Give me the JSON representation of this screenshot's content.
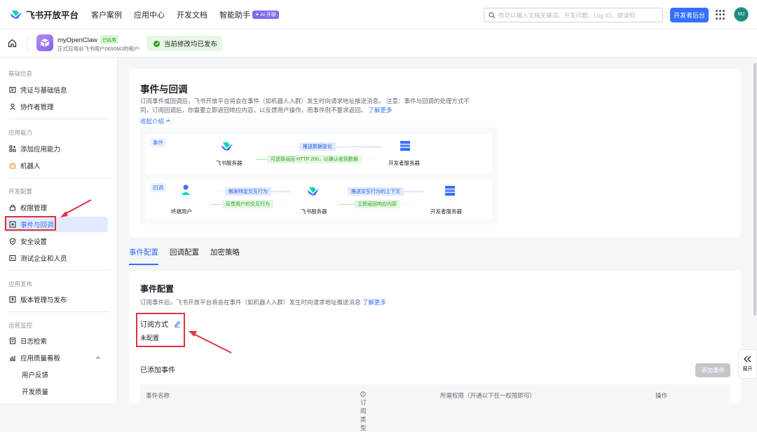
{
  "header": {
    "brand": "飞书开放平台",
    "nav": [
      "客户案例",
      "应用中心",
      "开发文档",
      "智能助手"
    ],
    "ai_badge": "✦ AI 开聊",
    "search_placeholder": "你可以输入文档关键词、开发问题、Log ID、错误码",
    "dev_console": "开发者后台",
    "avatar": "MJ"
  },
  "app": {
    "name": "myOpenClaw",
    "badge": "已启用",
    "subtitle": "正式应用@飞书用户0650MJ的租户",
    "status": "当前修改均已发布"
  },
  "sidebar": {
    "sections": [
      {
        "title": "基础信息",
        "items": [
          {
            "label": "凭证与基础信息",
            "icon": "credential-icon"
          },
          {
            "label": "协作者管理",
            "icon": "user-icon"
          }
        ]
      },
      {
        "title": "应用能力",
        "items": [
          {
            "label": "添加应用能力",
            "icon": "add-grid-icon"
          },
          {
            "label": "机器人",
            "icon": "robot-icon"
          }
        ]
      },
      {
        "title": "开发配置",
        "items": [
          {
            "label": "权限管理",
            "icon": "lock-icon"
          },
          {
            "label": "事件与回调",
            "icon": "event-icon"
          },
          {
            "label": "安全设置",
            "icon": "shield-icon"
          },
          {
            "label": "测试企业和人员",
            "icon": "test-icon"
          }
        ]
      },
      {
        "title": "应用发布",
        "items": [
          {
            "label": "版本管理与发布",
            "icon": "upload-icon"
          }
        ]
      },
      {
        "title": "运营监控",
        "items": [
          {
            "label": "日志检索",
            "icon": "log-icon"
          },
          {
            "label": "应用质量看板",
            "icon": "dashboard-icon"
          },
          {
            "label": "用户反馈",
            "icon": ""
          },
          {
            "label": "开发质量",
            "icon": ""
          }
        ]
      }
    ],
    "active": "事件与回调"
  },
  "intro": {
    "title": "事件与回调",
    "desc_line1": "订阅事件或回调后，飞书开放平台将会在事件（如机器人入群）发生时向请求地址推送消息。 注意：事件与回调的处理方式不",
    "desc_line2": "同，订阅回调后，你需要立即返回响应内容，以反馈用户操作，而事件则不要求返回。",
    "learn_more": "了解更多",
    "collapse": "收起介绍",
    "diagram": {
      "event_tag": "事件",
      "callback_tag": "回调",
      "feishu_server": "飞书服务器",
      "dev_server": "开发者服务器",
      "end_user": "终端用户",
      "push_data": "推送数据变化",
      "return_200": "可选择返回 HTTP 200，以确认收到数据",
      "trigger": "触发特定交互行为",
      "feedback": "反馈用户的交互行为",
      "push_context": "推送交互行为的上下文",
      "return_now": "立即返回响应内容"
    }
  },
  "tabs": [
    "事件配置",
    "回调配置",
    "加密策略"
  ],
  "event_config": {
    "title": "事件配置",
    "desc": "订阅事件后，飞书开放平台将会在事件（如机器人入群）发生时向请求地址推送消息",
    "learn_more": "了解更多",
    "sub_label": "订阅方式",
    "sub_value": "未配置",
    "added_title": "已添加事件",
    "add_button": "添加事件",
    "columns": [
      "事件名称",
      "订阅类型",
      "所需权限（开通以下任一权限即可）",
      "操作"
    ]
  },
  "expand_label": "展开",
  "colors": {
    "accent": "#3370ff",
    "highlight": "#e0323f",
    "success": "#2ea121"
  }
}
